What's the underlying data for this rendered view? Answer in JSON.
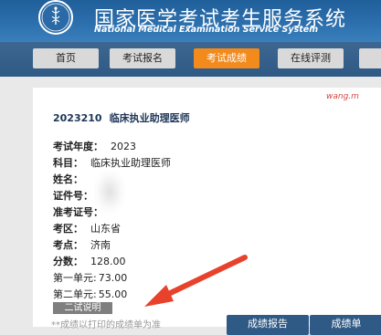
{
  "site": {
    "title": "国家医学考试考生服务系统",
    "subtitle": "National Medical Examination Service System",
    "logo_icon": "exam-center-seal-icon"
  },
  "nav": {
    "tabs": [
      {
        "label": "首页",
        "active": false
      },
      {
        "label": "考试报名",
        "active": false
      },
      {
        "label": "考试成绩",
        "active": true
      },
      {
        "label": "在线评测",
        "active": false
      }
    ]
  },
  "result": {
    "heading_code": "2023210",
    "heading_name": "临床执业助理医师",
    "fields": {
      "year": {
        "label": "考试年度：",
        "value": "2023"
      },
      "subject": {
        "label": "科目：",
        "value": "临床执业助理医师"
      },
      "name": {
        "label": "姓名：",
        "value": ""
      },
      "id_number": {
        "label": "证件号：",
        "value": ""
      },
      "ticket": {
        "label": "准考证号：",
        "value": ""
      },
      "region": {
        "label": "考区：",
        "value": "山东省"
      },
      "site": {
        "label": "考点：",
        "value": "济南"
      },
      "score": {
        "label": "分数：",
        "value": "128.00"
      },
      "unit1": {
        "label": "第一单元:",
        "value": "73.00"
      },
      "unit2": {
        "label": "第二单元:",
        "value": "55.00"
      }
    },
    "second_exam_button": "二试说明",
    "footnote": "**成绩以打印的成绩单为准",
    "report_button": "成绩报告",
    "transcript_button": "成绩单",
    "watermark": "wang.m"
  },
  "colors": {
    "banner": "#2c6fad",
    "navbar": "#2f5a85",
    "active_tab": "#f28a1c",
    "arrow": "#e8412c"
  }
}
